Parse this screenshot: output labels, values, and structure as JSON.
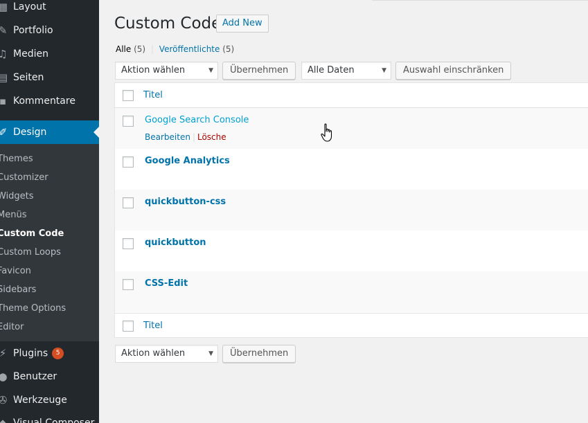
{
  "sidebar": {
    "items": [
      {
        "label": "Layout",
        "icon": "layout-icon"
      },
      {
        "label": "Portfolio",
        "icon": "portfolio-icon"
      },
      {
        "label": "Medien",
        "icon": "media-icon"
      },
      {
        "label": "Seiten",
        "icon": "pages-icon"
      },
      {
        "label": "Kommentare",
        "icon": "comments-icon"
      },
      {
        "label": "Design",
        "icon": "brush-icon"
      },
      {
        "label": "Plugins",
        "icon": "plugin-icon",
        "badge": "5"
      },
      {
        "label": "Benutzer",
        "icon": "users-icon"
      },
      {
        "label": "Werkzeuge",
        "icon": "tools-icon"
      },
      {
        "label": "Visual Composer",
        "icon": "composer-icon"
      }
    ],
    "submenu": [
      "Themes",
      "Customizer",
      "Widgets",
      "Menüs",
      "Custom Code",
      "Custom Loops",
      "Favicon",
      "Sidebars",
      "Theme Options",
      "Editor"
    ],
    "current_submenu": "Custom Code"
  },
  "header": {
    "title": "Custom Code",
    "add_new": "Add New"
  },
  "filters": {
    "all_label": "Alle",
    "all_count": "(5)",
    "sep": "|",
    "published_label": "Veröffentlichte",
    "published_count": "(5)"
  },
  "bulk": {
    "action_select": "Aktion wählen",
    "apply": "Übernehmen",
    "date_select": "Alle Daten",
    "filter_button": "Auswahl einschränken"
  },
  "table": {
    "column_title": "Titel",
    "rows": [
      {
        "title": "Google Search Console",
        "actions": {
          "edit": "Bearbeiten",
          "sep": "|",
          "trash": "Lösche"
        }
      },
      {
        "title": "Google Analytics"
      },
      {
        "title": "quickbutton-css"
      },
      {
        "title": "quickbutton"
      },
      {
        "title": "CSS-Edit"
      }
    ]
  },
  "colors": {
    "sidebar_bg": "#23282d",
    "active_bg": "#0073aa",
    "link": "#0073aa",
    "badge": "#d54e21",
    "trash": "#aa0000"
  }
}
